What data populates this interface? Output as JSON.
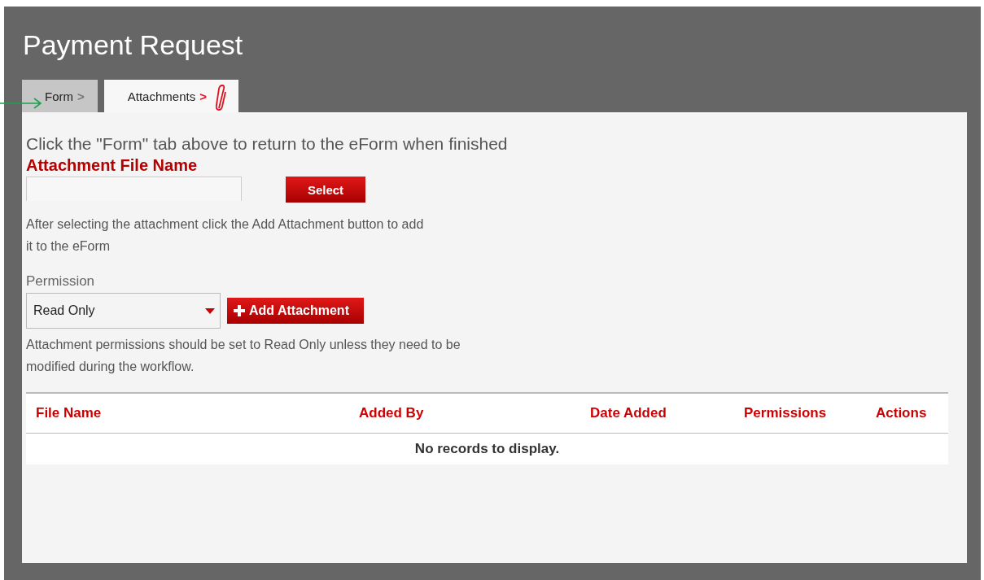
{
  "window": {
    "title": "Payment Request"
  },
  "tabs": [
    {
      "label": "Form",
      "selected": false,
      "chevron": ">",
      "attachment_icon": false
    },
    {
      "label": "Attachments",
      "selected": true,
      "chevron": ">",
      "attachment_icon": true
    }
  ],
  "instruction": "Click the \"Form\" tab above to return to the eForm when finished",
  "file_field": {
    "label": "Attachment File Name",
    "button": "Select"
  },
  "add_help": "After selecting the attachment click the Add Attachment button to add it to the eForm",
  "permission": {
    "label": "Permission",
    "value": "Read Only",
    "button": "Add Attachment"
  },
  "permission_help": "Attachment permissions should be set to Read Only unless they need to be modified during the workflow.",
  "table": {
    "columns": [
      "File Name",
      "Added By",
      "Date Added",
      "Permissions",
      "Actions"
    ],
    "empty_message": "No records to display."
  }
}
